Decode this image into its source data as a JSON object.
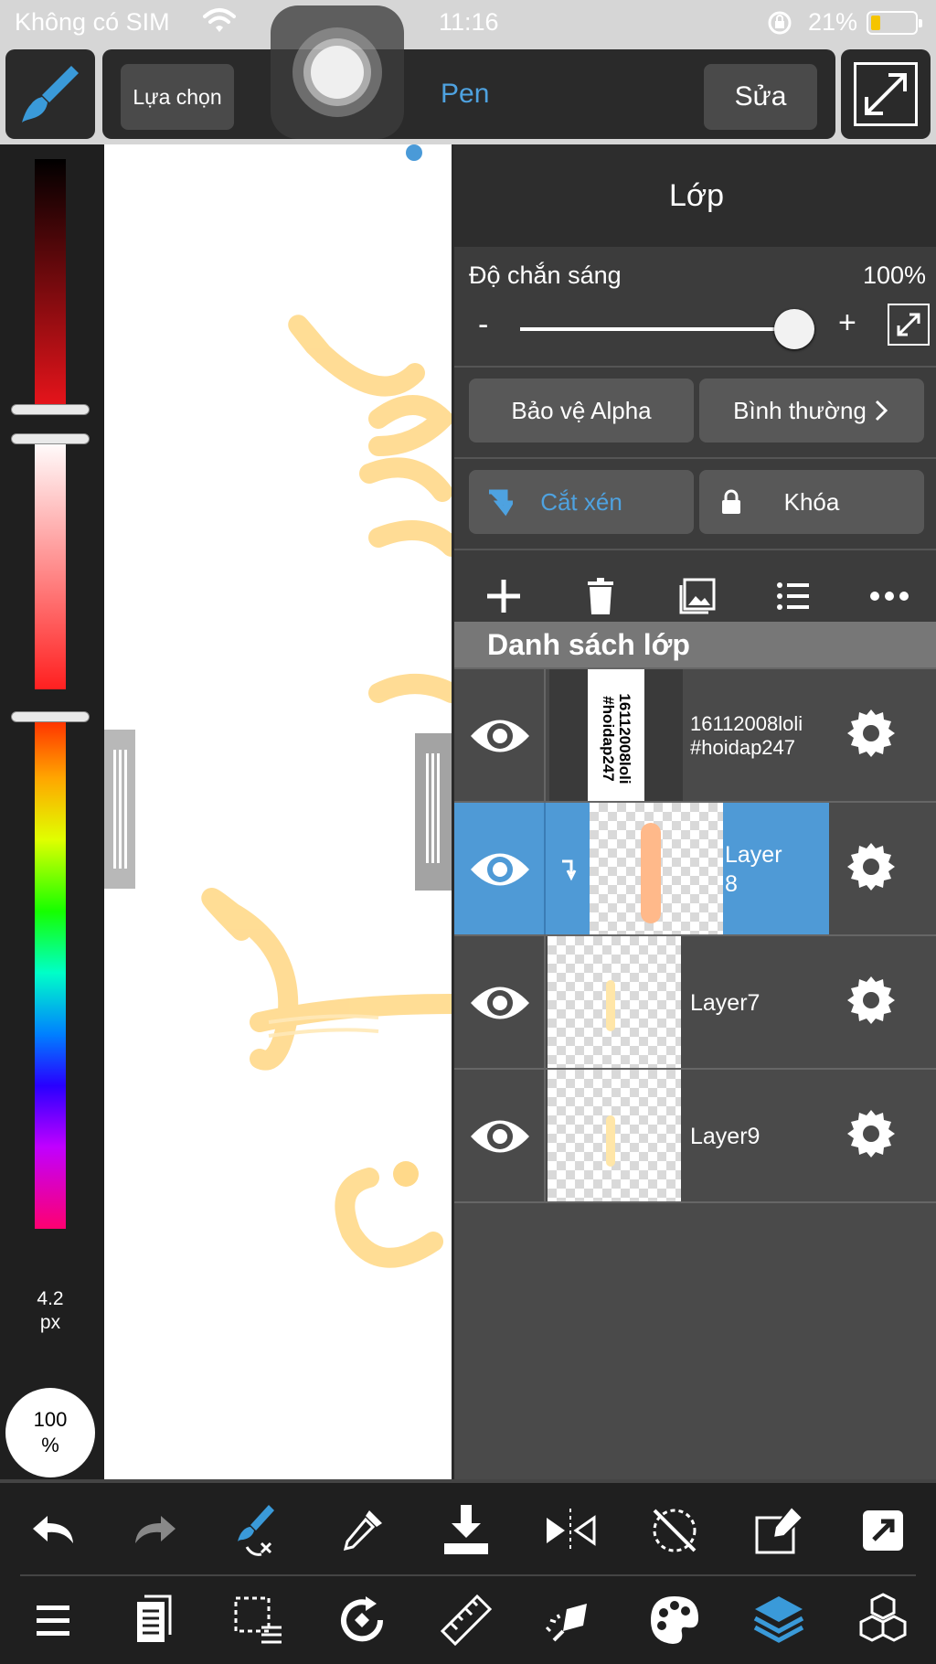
{
  "status_bar": {
    "carrier": "Không có SIM",
    "time": "11:16",
    "battery_percent": "21%",
    "battery_level": 0.21,
    "battery_color": "#f5c400"
  },
  "top_bar": {
    "selection_label": "Lựa chọn",
    "tool_name": "Pen",
    "edit_label": "Sửa",
    "brush_icon": "paintbrush-icon",
    "fullscreen_icon": "expand-icon",
    "tool_color": "#4ea2e0"
  },
  "left_panel": {
    "brush_size_value": "4.2",
    "brush_size_unit": "px",
    "opacity_value": "100",
    "opacity_unit": "%"
  },
  "layer_panel": {
    "title": "Lớp",
    "opacity_label": "Độ chắn sáng",
    "opacity_value": "100%",
    "opacity_level": 1.0,
    "minus": "-",
    "plus": "+",
    "alpha_protect": "Bảo vệ Alpha",
    "blend_mode": "Bình thường",
    "clipping": "Cắt xén",
    "lock": "Khóa",
    "list_title": "Danh sách lớp",
    "selected_color": "#4f9ad6",
    "layers": [
      {
        "name": "16112008loli\n#hoidap247",
        "thumb_text": "16112008loli #hoidap247",
        "visible": true,
        "selected": false,
        "clipped": false
      },
      {
        "name": "Layer\n8",
        "visible": true,
        "selected": true,
        "clipped": true
      },
      {
        "name": "Layer7",
        "visible": true,
        "selected": false,
        "clipped": false
      },
      {
        "name": "Layer9",
        "visible": true,
        "selected": false,
        "clipped": false
      }
    ]
  },
  "bottom_toolbar": {
    "row1": [
      "undo-icon",
      "redo-icon",
      "brush-transform-icon",
      "eyedropper-icon",
      "save-download-icon",
      "flip-horizontal-icon",
      "rotate-reset-icon",
      "edit-canvas-icon",
      "share-icon"
    ],
    "row2": [
      "menu-icon",
      "pages-icon",
      "selection-icon",
      "transform-rotate-icon",
      "ruler-icon",
      "fill-icon",
      "palette-icon",
      "layers-icon",
      "materials-icon"
    ],
    "active_icon": "layers-icon",
    "active_color": "#3a9ad9"
  }
}
